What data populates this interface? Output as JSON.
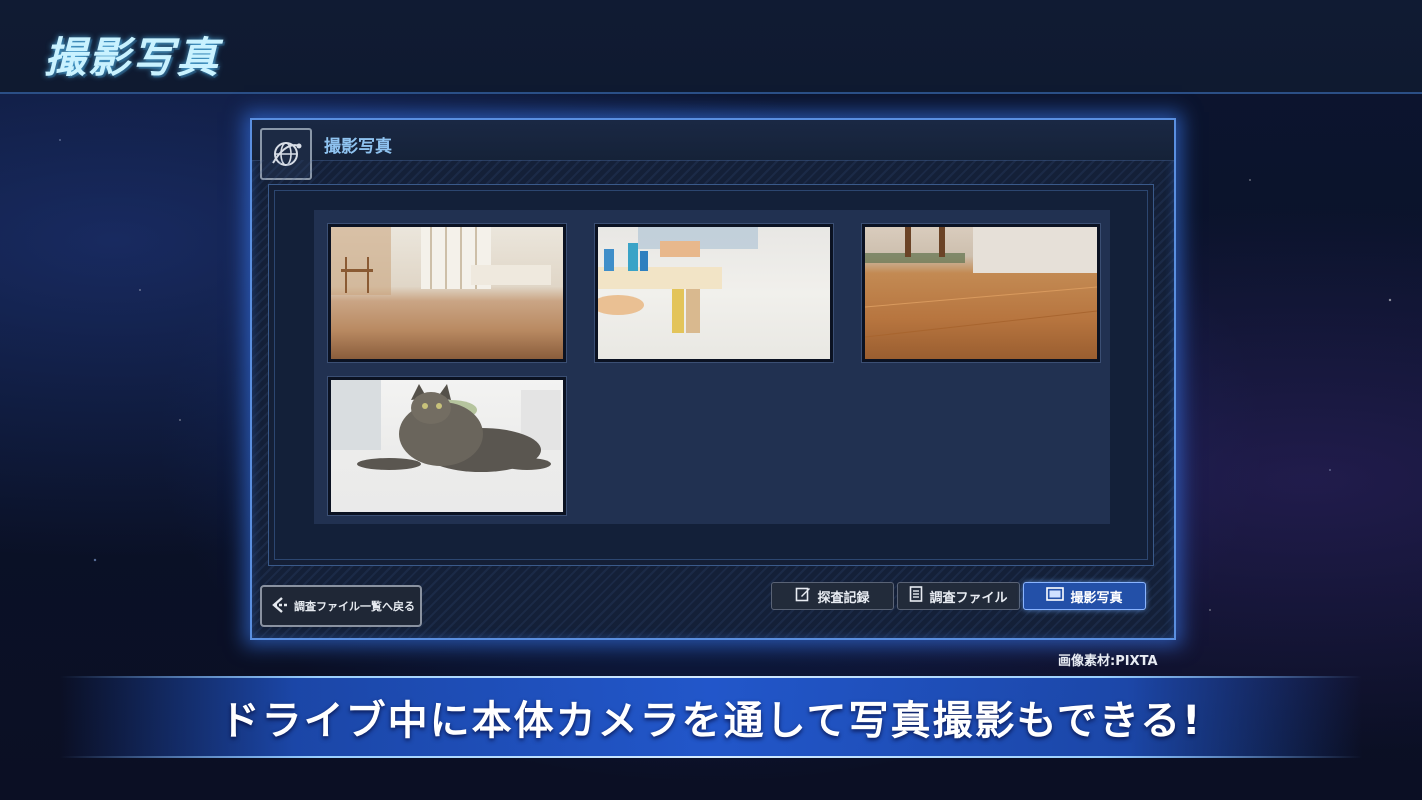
{
  "header": {
    "title": "撮影写真"
  },
  "window": {
    "title": "撮影写真",
    "icon": "globe-satellite-icon",
    "photos": [
      {
        "label": "living-room-floor-photo"
      },
      {
        "label": "toy-blocks-photo"
      },
      {
        "label": "wood-floor-photo"
      },
      {
        "label": "tabby-cat-photo"
      }
    ],
    "back_button": {
      "label": "調査ファイル一覧へ戻る",
      "icon": "back-arrow-icon"
    },
    "tabs": [
      {
        "label": "探査記録",
        "icon": "edit-icon"
      },
      {
        "label": "調査ファイル",
        "icon": "document-icon"
      },
      {
        "label": "撮影写真",
        "icon": "photo-frame-icon",
        "active": true
      }
    ]
  },
  "credit": "画像素材:PIXTA",
  "caption": "ドライブ中に本体カメラを通して写真撮影もできる!",
  "colors": {
    "accent": "#5a8fe0",
    "active_tab": "#2350a8",
    "banner": "#2359d2"
  }
}
